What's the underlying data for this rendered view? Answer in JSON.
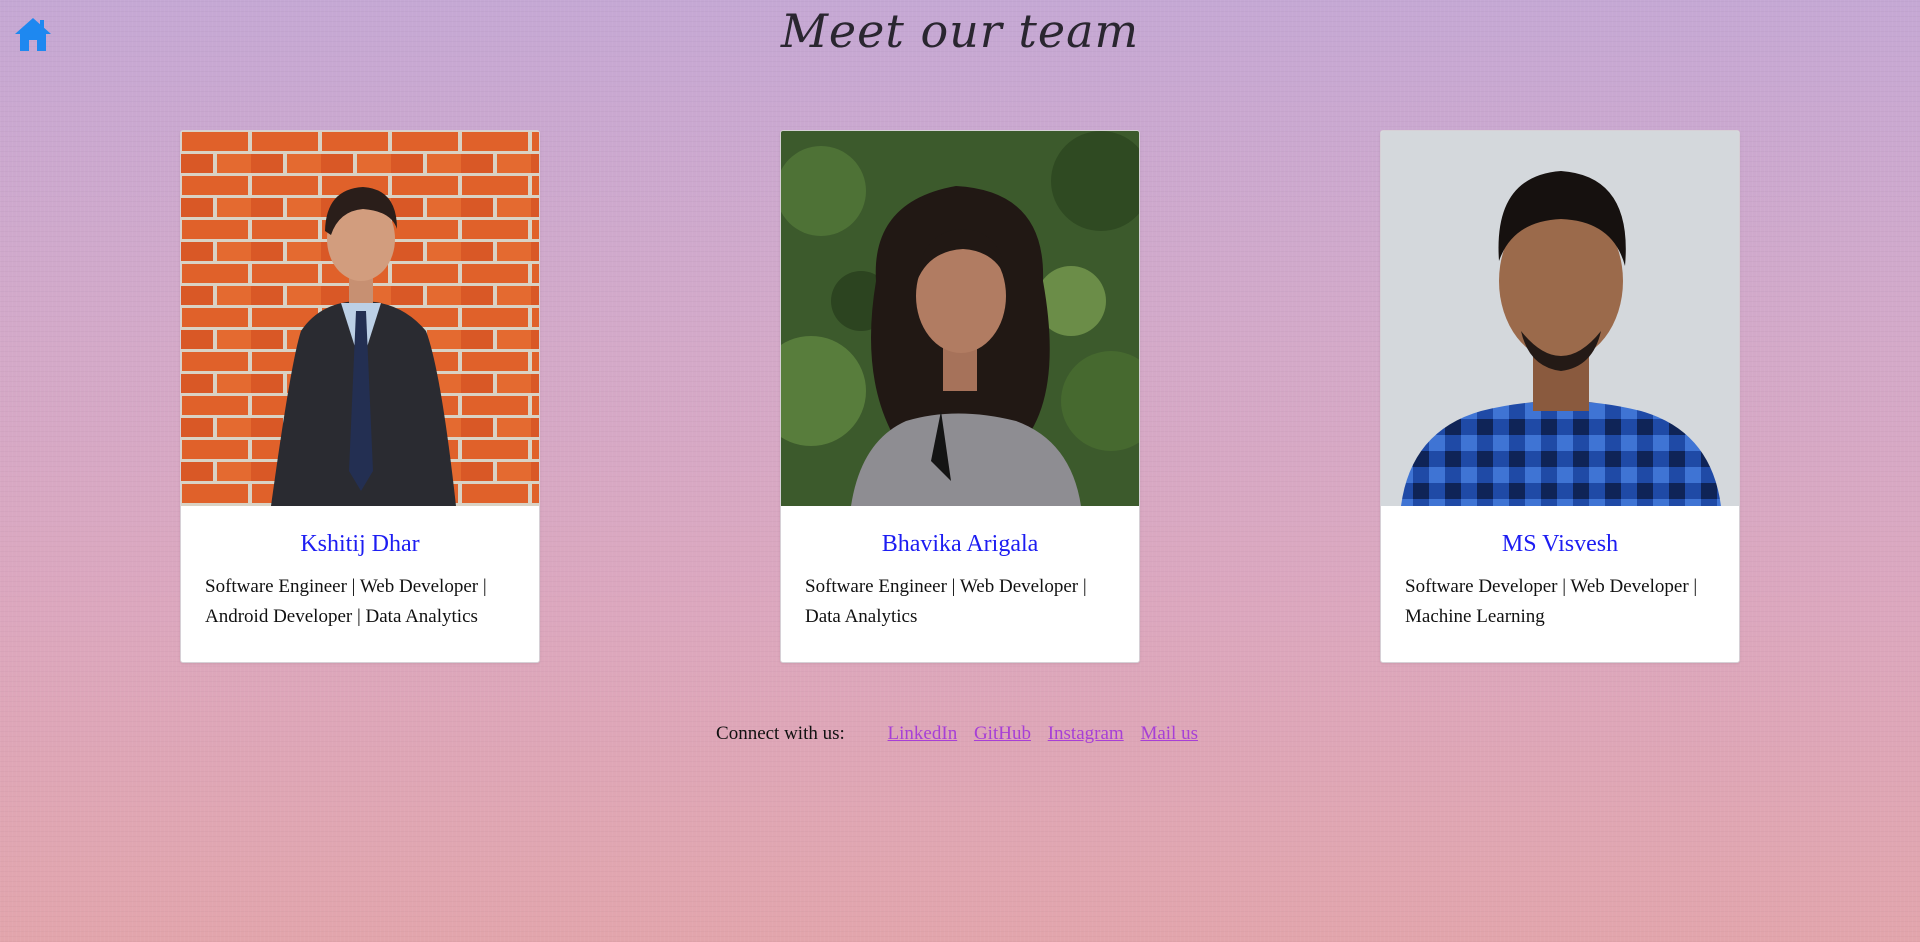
{
  "page": {
    "title": "Meet our team",
    "home_icon": "home-icon",
    "colors": {
      "accent": "#1d1df2",
      "link": "#a73fd6",
      "home_icon": "#1e88f0"
    }
  },
  "team": [
    {
      "name": "Kshitij Dhar",
      "role": "Software Engineer | Web Developer | Android Developer | Data Analytics"
    },
    {
      "name": "Bhavika Arigala",
      "role": "Software Engineer | Web Developer | Data Analytics"
    },
    {
      "name": "MS Visvesh",
      "role": "Software Developer | Web Developer | Machine Learning"
    }
  ],
  "footer": {
    "label": "Connect with us:",
    "links": [
      "LinkedIn",
      "GitHub",
      "Instagram",
      "Mail us"
    ]
  }
}
